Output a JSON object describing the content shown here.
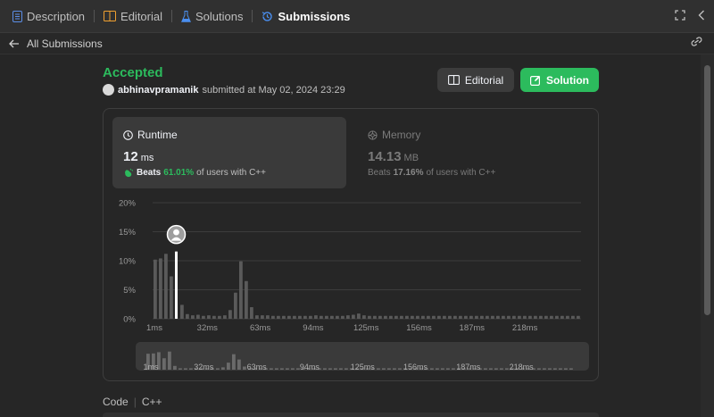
{
  "tabs": [
    {
      "label": "Description",
      "icon": "document-icon",
      "color": "#5c8ee6"
    },
    {
      "label": "Editorial",
      "icon": "book-icon",
      "color": "#f0a030"
    },
    {
      "label": "Solutions",
      "icon": "flask-icon",
      "color": "#4a8ff0"
    },
    {
      "label": "Submissions",
      "icon": "history-icon",
      "color": "#4a8ff0"
    }
  ],
  "back_label": "All Submissions",
  "submission": {
    "status": "Accepted",
    "user": "abhinavpramanik",
    "submitted_text": "submitted at May 02, 2024 23:29"
  },
  "buttons": {
    "editorial": "Editorial",
    "solution": "Solution"
  },
  "runtime": {
    "title": "Runtime",
    "value": "12",
    "unit": "ms",
    "beats_label": "Beats",
    "beats_pct": "61.01%",
    "beats_suffix": "of users with C++"
  },
  "memory": {
    "title": "Memory",
    "value": "14.13",
    "unit": "MB",
    "beats_label": "Beats",
    "beats_pct": "17.16%",
    "beats_suffix": "of users with C++"
  },
  "code_label": "Code",
  "language": "C++",
  "colors": {
    "accent": "#2cbb5d",
    "bar": "#5a5a5a",
    "highlight": "#ffffff"
  },
  "chart_data": {
    "type": "bar",
    "y_ticks": [
      "0%",
      "5%",
      "10%",
      "15%",
      "20%"
    ],
    "ylim": [
      0,
      20
    ],
    "x_ticks": [
      "1ms",
      "32ms",
      "63ms",
      "94ms",
      "125ms",
      "156ms",
      "187ms",
      "218ms"
    ],
    "x": [
      0,
      1,
      2,
      3,
      4,
      5,
      6,
      7,
      8,
      9,
      10,
      11,
      12,
      13,
      14,
      15,
      16,
      17,
      18,
      19,
      20,
      21,
      22,
      23,
      24,
      25,
      26,
      27,
      28,
      29,
      30,
      31,
      32,
      33,
      34,
      35,
      36,
      37,
      38,
      39,
      40,
      41,
      42,
      43,
      44,
      45,
      46,
      47,
      48,
      49,
      50,
      51,
      52,
      53,
      54,
      55,
      56,
      57,
      58,
      59,
      60,
      61,
      62,
      63,
      64,
      65,
      66,
      67,
      68,
      69,
      70,
      71,
      72,
      73,
      74,
      75,
      76,
      77,
      78,
      79
    ],
    "values": [
      10.2,
      10.4,
      11.2,
      7.3,
      11.6,
      2.4,
      0.8,
      0.6,
      0.7,
      0.5,
      0.6,
      0.5,
      0.5,
      0.6,
      1.5,
      4.5,
      9.9,
      6.5,
      2.0,
      0.6,
      0.6,
      0.6,
      0.5,
      0.5,
      0.5,
      0.5,
      0.5,
      0.5,
      0.5,
      0.5,
      0.6,
      0.5,
      0.5,
      0.5,
      0.5,
      0.5,
      0.6,
      0.7,
      0.9,
      0.6,
      0.5,
      0.5,
      0.5,
      0.5,
      0.5,
      0.5,
      0.5,
      0.5,
      0.5,
      0.5,
      0.5,
      0.5,
      0.5,
      0.5,
      0.5,
      0.5,
      0.5,
      0.5,
      0.5,
      0.5,
      0.5,
      0.5,
      0.5,
      0.5,
      0.5,
      0.5,
      0.5,
      0.5,
      0.5,
      0.5,
      0.5,
      0.5,
      0.5,
      0.5,
      0.5,
      0.5,
      0.5,
      0.5,
      0.5,
      0.5
    ],
    "highlight_index": 4,
    "grid": true
  }
}
